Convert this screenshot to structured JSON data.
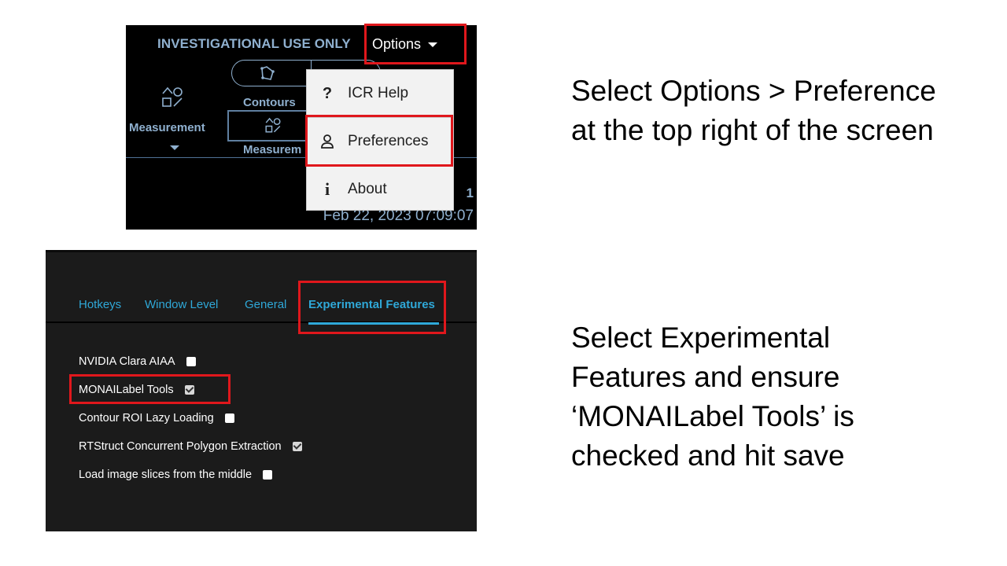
{
  "top_screenshot": {
    "warning_text": "INVESTIGATIONAL USE ONLY",
    "options_label": "Options",
    "contours_label": "Contours",
    "measurement_label": "Measurement",
    "measurement_truncated_label": "Measurem",
    "menu": {
      "items": [
        {
          "label": "ICR Help",
          "icon": "question-icon"
        },
        {
          "label": "Preferences",
          "icon": "person-icon"
        },
        {
          "label": "About",
          "icon": "info-icon"
        }
      ]
    },
    "page_number": "1",
    "timestamp": "Feb 22, 2023 07:09:07"
  },
  "bottom_screenshot": {
    "tabs": [
      {
        "label": "Hotkeys",
        "active": false
      },
      {
        "label": "Window Level",
        "active": false
      },
      {
        "label": "General",
        "active": false
      },
      {
        "label": "Experimental Features",
        "active": true
      }
    ],
    "settings": [
      {
        "label": "NVIDIA Clara AIAA",
        "checked": false
      },
      {
        "label": "MONAILabel Tools",
        "checked": true
      },
      {
        "label": "Contour ROI Lazy Loading",
        "checked": false
      },
      {
        "label": "RTStruct Concurrent Polygon Extraction",
        "checked": true
      },
      {
        "label": "Load image slices from the middle",
        "checked": false
      }
    ]
  },
  "instructions": {
    "step1_line1": "Select Options > Preference",
    "step1_line2": "at the top right of the screen",
    "step2_line1": "Select Experimental",
    "step2_line2": "Features and ensure",
    "step2_line3": "‘MONAILabel Tools’ is",
    "step2_line4": "checked and hit save"
  },
  "colors": {
    "highlight": "#e0171c",
    "accent_blue": "#2fa8d8",
    "ui_text_blue": "#8fb0cf"
  }
}
